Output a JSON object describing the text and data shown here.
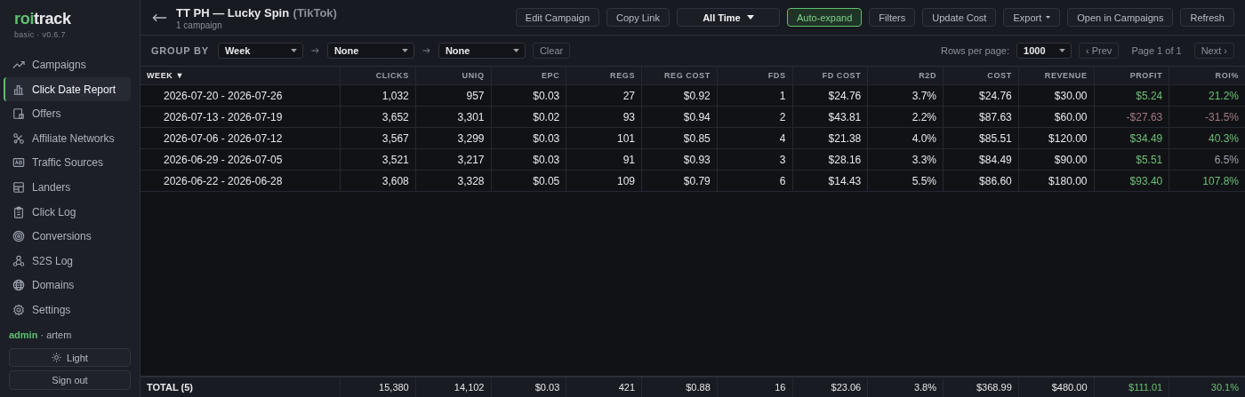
{
  "brand": {
    "accent": "roi",
    "rest": "track",
    "edition": "basic · v0.6.7"
  },
  "sidebar": {
    "items": [
      {
        "label": "Campaigns",
        "selected": false
      },
      {
        "label": "Click Date Report",
        "selected": true
      },
      {
        "label": "Offers",
        "selected": false
      },
      {
        "label": "Affiliate Networks",
        "selected": false
      },
      {
        "label": "Traffic Sources",
        "selected": false
      },
      {
        "label": "Landers",
        "selected": false
      },
      {
        "label": "Click Log",
        "selected": false
      },
      {
        "label": "Conversions",
        "selected": false
      },
      {
        "label": "S2S Log",
        "selected": false
      },
      {
        "label": "Domains",
        "selected": false
      },
      {
        "label": "Settings",
        "selected": false
      }
    ],
    "user": {
      "role": "admin",
      "rest": "· artem"
    },
    "theme_button": "Light",
    "signout_button": "Sign out"
  },
  "header": {
    "title": "TT PH — Lucky Spin",
    "source": "(TikTok)",
    "subtitle": "1 campaign",
    "buttons": [
      {
        "label": "Edit Campaign",
        "kind": "button"
      },
      {
        "label": "Copy Link",
        "kind": "button"
      },
      {
        "label": "All Time",
        "kind": "dropdown"
      },
      {
        "label": "Auto-expand",
        "kind": "toggle",
        "on": true
      },
      {
        "label": "Filters",
        "kind": "button"
      },
      {
        "label": "Update Cost",
        "kind": "button"
      },
      {
        "label": "Export",
        "kind": "menu"
      },
      {
        "label": "Open in Campaigns",
        "kind": "button"
      },
      {
        "label": "Refresh",
        "kind": "button"
      }
    ]
  },
  "group_bar": {
    "label": "GROUP BY",
    "selects": [
      "Week",
      "None",
      "None"
    ],
    "clear": "Clear",
    "rows_label": "Rows per page:",
    "rows_value": "1000",
    "prev": "‹ Prev",
    "page": "Page 1 of 1",
    "next": "Next ›"
  },
  "table": {
    "columns": [
      "WEEK ▼",
      "CLICKS",
      "UNIQ",
      "EPC",
      "REGS",
      "REG COST",
      "FDS",
      "FD COST",
      "R2D",
      "COST",
      "REVENUE",
      "PROFIT",
      "ROI%"
    ],
    "rows": [
      {
        "cells": [
          "2026-07-20 - 2026-07-26",
          "1,032",
          "957",
          "$0.03",
          "27",
          "$0.92",
          "1",
          "$24.76",
          "3.7%",
          "$24.76",
          "$30.00"
        ],
        "profit": {
          "text": "$5.24",
          "color": "#6cbf76"
        },
        "roi": {
          "text": "21.2%",
          "color": "#6cbf76"
        }
      },
      {
        "cells": [
          "2026-07-13 - 2026-07-19",
          "3,652",
          "3,301",
          "$0.02",
          "93",
          "$0.94",
          "2",
          "$43.81",
          "2.2%",
          "$87.63",
          "$60.00"
        ],
        "profit": {
          "text": "-$27.63",
          "color": "#a07a80"
        },
        "roi": {
          "text": "-31.5%",
          "color": "#a07a80"
        }
      },
      {
        "cells": [
          "2026-07-06 - 2026-07-12",
          "3,567",
          "3,299",
          "$0.03",
          "101",
          "$0.85",
          "4",
          "$21.38",
          "4.0%",
          "$85.51",
          "$120.00"
        ],
        "profit": {
          "text": "$34.49",
          "color": "#6cbf76"
        },
        "roi": {
          "text": "40.3%",
          "color": "#6cbf76"
        }
      },
      {
        "cells": [
          "2026-06-29 - 2026-07-05",
          "3,521",
          "3,217",
          "$0.03",
          "91",
          "$0.93",
          "3",
          "$28.16",
          "3.3%",
          "$84.49",
          "$90.00"
        ],
        "profit": {
          "text": "$5.51",
          "color": "#6cbf76"
        },
        "roi": {
          "text": "6.5%",
          "color": "#9ba0a9"
        }
      },
      {
        "cells": [
          "2026-06-22 - 2026-06-28",
          "3,608",
          "3,328",
          "$0.05",
          "109",
          "$0.79",
          "6",
          "$14.43",
          "5.5%",
          "$86.60",
          "$180.00"
        ],
        "profit": {
          "text": "$93.40",
          "color": "#6cbf76"
        },
        "roi": {
          "text": "107.8%",
          "color": "#6cbf76"
        }
      }
    ],
    "total": {
      "cells": [
        "TOTAL (5)",
        "15,380",
        "14,102",
        "$0.03",
        "421",
        "$0.88",
        "16",
        "$23.06",
        "3.8%",
        "$368.99",
        "$480.00"
      ],
      "profit": {
        "text": "$111.01",
        "color": "#6cbf76"
      },
      "roi": {
        "text": "30.1%",
        "color": "#6cbf76"
      }
    }
  }
}
